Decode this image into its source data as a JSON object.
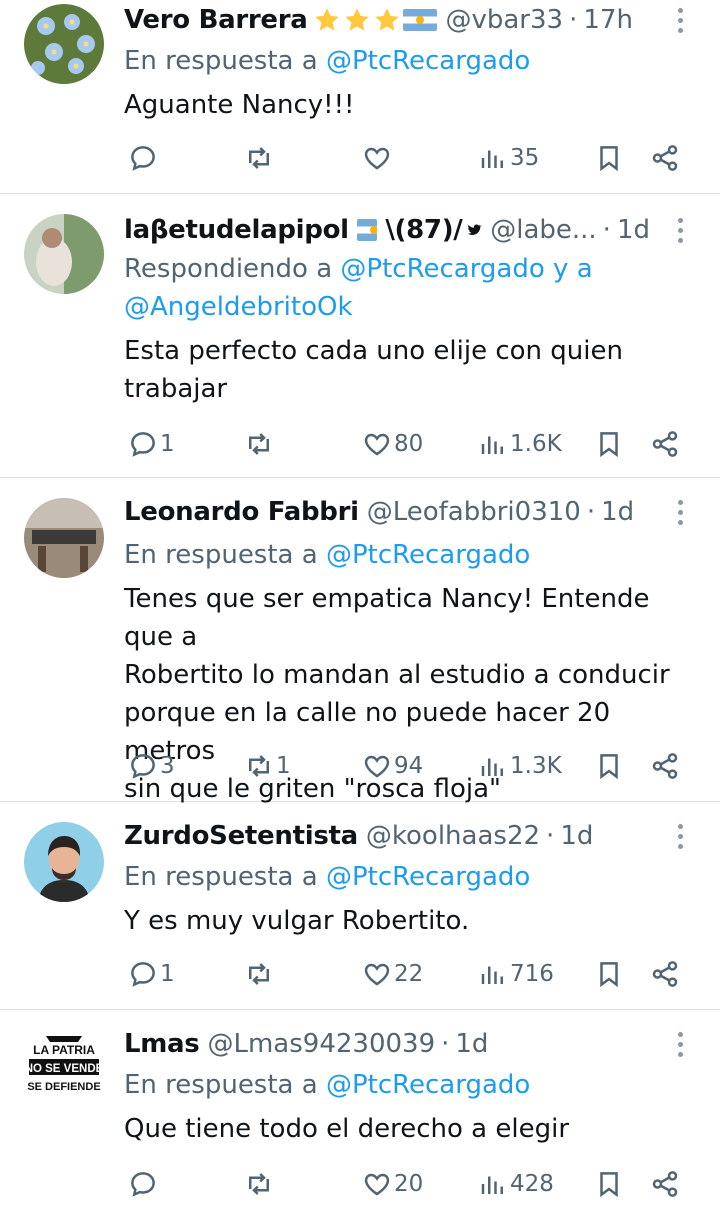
{
  "colors": {
    "accent": "#1d9bf0",
    "muted": "#536471",
    "text": "#0f1419",
    "divider": "#dfe3e6"
  },
  "tweets": [
    {
      "name": "Vero Barrera",
      "handle": "@vbar33",
      "time": "17h",
      "badges": [
        "star-emoji",
        "star-emoji",
        "star-emoji",
        "argentina-flag"
      ],
      "reply_prefix": "En respuesta a",
      "reply_mentions": "@PtcRecargado",
      "text": "Aguante Nancy!!!",
      "replies": "",
      "retweets": "",
      "likes": "",
      "views": "35"
    },
    {
      "name": "laβetudelapipol",
      "name_suffix": "\\(87)/",
      "handle": "@labe...",
      "time": "1d",
      "badges": [
        "argentina-flag",
        "bird-emoji"
      ],
      "reply_prefix": "Respondiendo a",
      "reply_mentions": "@PtcRecargado y a",
      "reply_mentions_2": "@AngeldebritoOk",
      "text_line1": "Esta perfecto cada uno elije con quien",
      "text_line2": "trabajar",
      "replies": "1",
      "retweets": "",
      "likes": "80",
      "views": "1.6K"
    },
    {
      "name": "Leonardo Fabbri",
      "handle": "@Leofabbri0310",
      "time": "1d",
      "reply_prefix": "En respuesta a",
      "reply_mentions": "@PtcRecargado",
      "text_line1": "Tenes que ser empatica Nancy! Entende que a",
      "text_line2": "Robertito lo mandan al estudio a conducir",
      "text_line3": "porque en la calle no puede hacer 20 metros",
      "text_line4": "sin que le griten \"rosca floja\"",
      "replies": "3",
      "retweets": "1",
      "likes": "94",
      "views": "1.3K"
    },
    {
      "name": "ZurdoSetentista",
      "handle": "@koolhaas22",
      "time": "1d",
      "reply_prefix": "En respuesta a",
      "reply_mentions": "@PtcRecargado",
      "text": "Y es muy vulgar Robertito.",
      "replies": "1",
      "retweets": "",
      "likes": "22",
      "views": "716"
    },
    {
      "name": "Lmas",
      "handle": "@Lmas94230039",
      "time": "1d",
      "avatar_text": [
        "LA PATRIA",
        "NO SE VENDE",
        "SE DEFIENDE"
      ],
      "reply_prefix": "En respuesta a",
      "reply_mentions": "@PtcRecargado",
      "text": "Que tiene todo el derecho a elegir",
      "replies": "",
      "retweets": "",
      "likes": "20",
      "views": "428"
    }
  ],
  "dot": "·"
}
